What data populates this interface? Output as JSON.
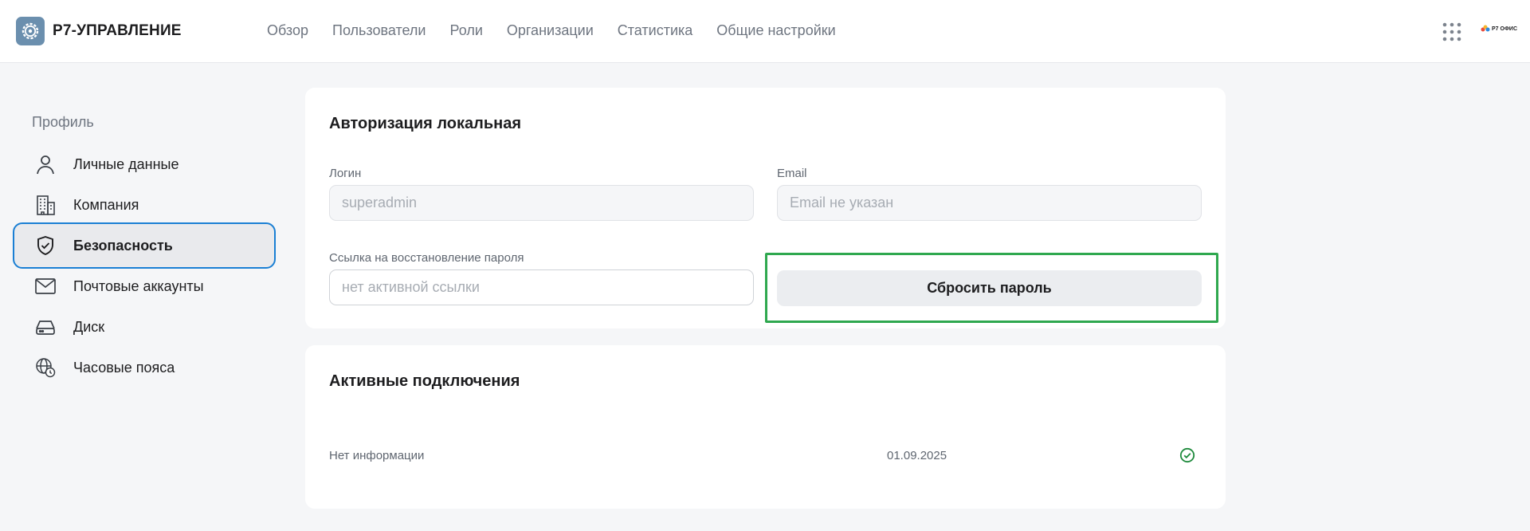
{
  "app": {
    "name": "Р7-УПРАВЛЕНИЕ",
    "logo_icon": "gear-icon",
    "brand_mini": "Р7 ОФИС"
  },
  "topnav": [
    {
      "label": "Обзор"
    },
    {
      "label": "Пользователи"
    },
    {
      "label": "Роли"
    },
    {
      "label": "Организации"
    },
    {
      "label": "Статистика"
    },
    {
      "label": "Общие настройки"
    }
  ],
  "sidebar": {
    "heading": "Профиль",
    "items": [
      {
        "label": "Личные данные",
        "icon": "user-icon",
        "active": false
      },
      {
        "label": "Компания",
        "icon": "building-icon",
        "active": false
      },
      {
        "label": "Безопасность",
        "icon": "shield-check-icon",
        "active": true
      },
      {
        "label": "Почтовые аккаунты",
        "icon": "mail-icon",
        "active": false
      },
      {
        "label": "Диск",
        "icon": "disk-icon",
        "active": false
      },
      {
        "label": "Часовые пояса",
        "icon": "globe-clock-icon",
        "active": false
      }
    ]
  },
  "auth_card": {
    "title": "Авторизация локальная",
    "login": {
      "label": "Логин",
      "value": "superadmin"
    },
    "email": {
      "label": "Email",
      "placeholder": "Email не указан"
    },
    "recovery_link": {
      "label": "Ссылка на восстановление пароля",
      "placeholder": "нет активной ссылки"
    },
    "reset_button": "Сбросить пароль"
  },
  "sessions_card": {
    "title": "Активные подключения",
    "rows": [
      {
        "info": "Нет информации",
        "date": "01.09.2025",
        "status_icon": "check-circle-icon"
      }
    ]
  },
  "colors": {
    "accent": "#1a7fd4",
    "highlight": "#2fa84f",
    "logo_bg": "#6b8fae",
    "success": "#1e8a3c"
  }
}
